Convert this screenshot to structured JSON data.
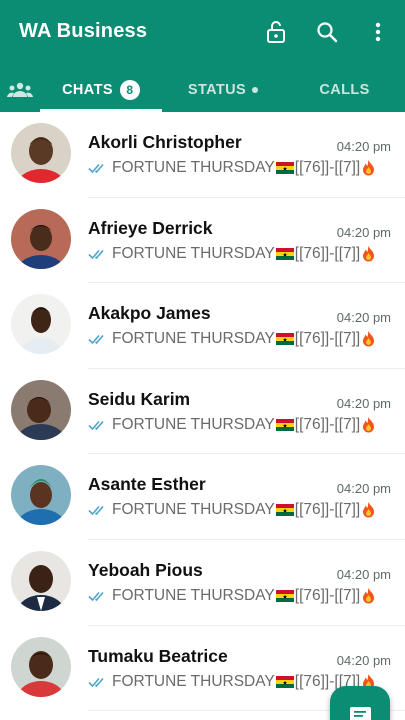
{
  "app": {
    "title": "WA Business"
  },
  "colors": {
    "primary": "#0b8d73",
    "tick": "#4fa3c7"
  },
  "icons": {
    "lock": "lock-open-icon",
    "search": "search-icon",
    "menu": "more-vert-icon",
    "community": "community-icon",
    "fab": "new-chat-icon"
  },
  "tabs": [
    {
      "label": "CHATS",
      "badge": "8"
    },
    {
      "label": "STATUS"
    },
    {
      "label": "CALLS"
    }
  ],
  "chats": [
    {
      "name": "Akorli Christopher",
      "time": "04:20 pm",
      "message": "FORTUNE THURSDAY",
      "suffix": "[[76]]-[[7]]"
    },
    {
      "name": "Afrieye Derrick",
      "time": "04:20 pm",
      "message": "FORTUNE THURSDAY",
      "suffix": "[[76]]-[[7]]"
    },
    {
      "name": "Akakpo James",
      "time": "04:20 pm",
      "message": "FORTUNE THURSDAY",
      "suffix": "[[76]]-[[7]]"
    },
    {
      "name": "Seidu Karim",
      "time": "04:20 pm",
      "message": "FORTUNE THURSDAY",
      "suffix": "[[76]]-[[7]]"
    },
    {
      "name": "Asante Esther",
      "time": "04:20 pm",
      "message": "FORTUNE THURSDAY",
      "suffix": "[[76]]-[[7]]"
    },
    {
      "name": "Yeboah Pious",
      "time": "04:20 pm",
      "message": "FORTUNE THURSDAY",
      "suffix": "[[76]]-[[7]]"
    },
    {
      "name": "Tumaku Beatrice",
      "time": "04:20 pm",
      "message": "FORTUNE THURSDAY",
      "suffix": "[[76]]-[[7]]"
    }
  ]
}
